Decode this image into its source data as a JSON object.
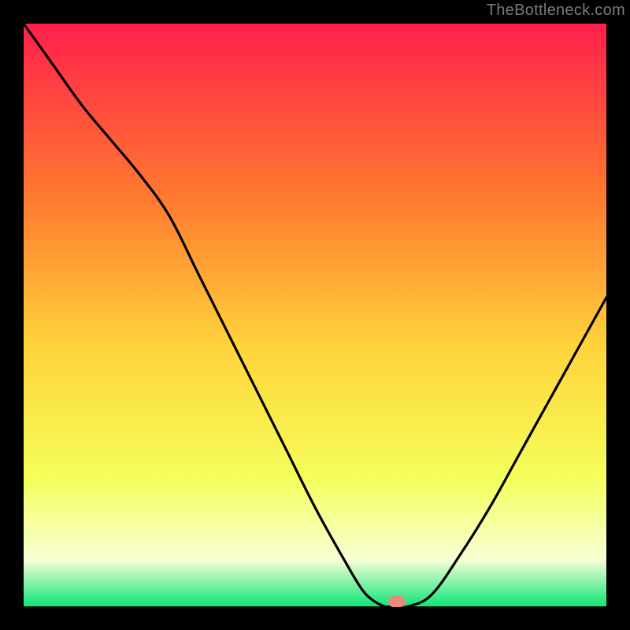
{
  "watermark": "TheBottleneck.com",
  "colors": {
    "background": "#000000",
    "gradient_top": "#ff1f4b",
    "gradient_upper": "#ff7a2f",
    "gradient_mid": "#ffd23a",
    "gradient_lower": "#f4ff5a",
    "gradient_pale": "#f8ffd6",
    "gradient_bottom": "#0fe678",
    "curve": "#000000",
    "marker": "#e98a7e"
  },
  "chart_data": {
    "type": "line",
    "title": "",
    "xlabel": "",
    "ylabel": "",
    "xlim": [
      0,
      100
    ],
    "ylim": [
      0,
      100
    ],
    "grid": false,
    "legend": false,
    "series": [
      {
        "name": "curve",
        "x": [
          0,
          5,
          10,
          15,
          20,
          25,
          30,
          35,
          40,
          45,
          50,
          55,
          58,
          60,
          62,
          64,
          66,
          70,
          75,
          80,
          85,
          90,
          95,
          100
        ],
        "y": [
          100,
          93,
          86,
          80,
          74,
          67,
          57,
          47,
          37,
          27,
          17,
          8,
          3,
          1,
          0,
          0,
          0,
          2,
          9,
          17,
          26,
          35,
          44,
          53
        ]
      }
    ],
    "annotations": [
      {
        "name": "optimum-marker",
        "x": 64,
        "y": 0,
        "shape": "pill",
        "color": "#e98a7e"
      }
    ]
  }
}
